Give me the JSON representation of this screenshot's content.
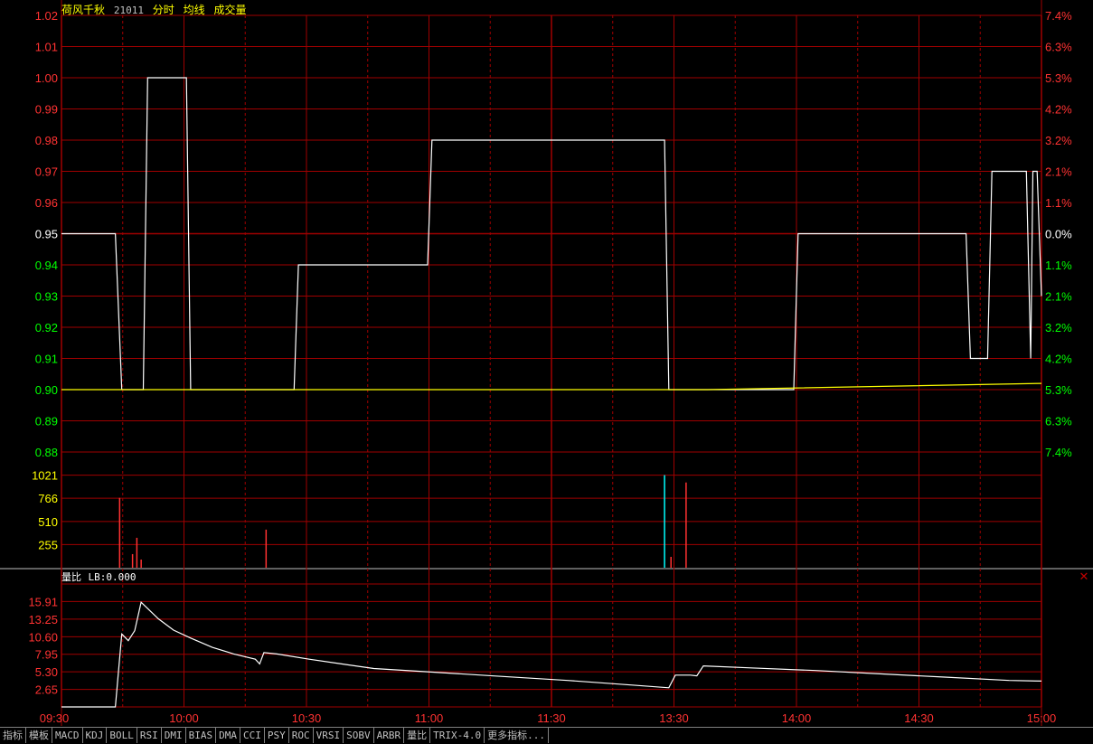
{
  "header": {
    "name": "荷风千秋",
    "code": "21011",
    "mode": "分时",
    "avg_label": "均线",
    "vol_label": "成交量"
  },
  "price_axis": {
    "left_labels": [
      "1.02",
      "1.01",
      "1.00",
      "0.99",
      "0.98",
      "0.97",
      "0.96",
      "0.95",
      "0.94",
      "0.93",
      "0.92",
      "0.91",
      "0.90",
      "0.89",
      "0.88"
    ],
    "right_labels": [
      "7.4%",
      "6.3%",
      "5.3%",
      "4.2%",
      "3.2%",
      "2.1%",
      "1.1%",
      "0.0%",
      "1.1%",
      "2.1%",
      "3.2%",
      "4.2%",
      "5.3%",
      "6.3%",
      "7.4%"
    ],
    "prev_close": 0.95
  },
  "volume_axis": {
    "labels": [
      "1021",
      "766",
      "510",
      "255"
    ]
  },
  "indicator": {
    "name": "量比",
    "value_text": "LB:0.000",
    "labels": [
      "15.91",
      "13.25",
      "10.60",
      "7.95",
      "5.30",
      "2.65"
    ]
  },
  "time_labels": [
    "09:30",
    "10:00",
    "10:30",
    "11:00",
    "11:30",
    "13:30",
    "14:00",
    "14:30",
    "15:00"
  ],
  "tabs": [
    "指标",
    "模板",
    "MACD",
    "KDJ",
    "BOLL",
    "RSI",
    "DMI",
    "BIAS",
    "DMA",
    "CCI",
    "PSY",
    "ROC",
    "VRSI",
    "SOBV",
    "ARBR",
    "量比",
    "TRIX-4.0",
    "更多指标..."
  ],
  "colors": {
    "grid": "#a00000",
    "up": "#ff3232",
    "down": "#00ff00",
    "flat": "#ffffff",
    "price_line": "#ffffff",
    "avg_line": "#ffff00",
    "volume_up": "#ff3232",
    "volume_down": "#00ffff",
    "axis_yellow": "#ffff00"
  },
  "chart_data": {
    "type": "line",
    "title": "",
    "x_unit": "minute index (0-240, 09:30-15:00)",
    "ylim": [
      0.88,
      1.02
    ],
    "series": [
      {
        "name": "",
        "points": [
          [
            0,
            0.95
          ],
          [
            25,
            0.95
          ],
          [
            28,
            0.9
          ],
          [
            38,
            0.9
          ],
          [
            40,
            1.0
          ],
          [
            58,
            1.0
          ],
          [
            60,
            0.9
          ],
          [
            108,
            0.9
          ],
          [
            110,
            0.94
          ],
          [
            170,
            0.94
          ],
          [
            172,
            0.98
          ],
          [
            280,
            0.98
          ],
          [
            282,
            0.9
          ],
          [
            296,
            0.9
          ],
          [
            300,
            0.9
          ],
          [
            340,
            0.9
          ],
          [
            342,
            0.95
          ],
          [
            420,
            0.95
          ],
          [
            422,
            0.91
          ],
          [
            430,
            0.91
          ],
          [
            432,
            0.97
          ],
          [
            448,
            0.97
          ],
          [
            450,
            0.91
          ],
          [
            451,
            0.97
          ],
          [
            453,
            0.97
          ],
          [
            455,
            0.93
          ]
        ]
      },
      {
        "name": "",
        "points": [
          [
            0,
            0.9
          ],
          [
            100,
            0.9
          ],
          [
            300,
            0.9
          ],
          [
            455,
            0.902
          ]
        ]
      }
    ],
    "volume": {
      "ylim": [
        0,
        1276
      ],
      "bars": [
        [
          27,
          770,
          "up"
        ],
        [
          33,
          150,
          "up"
        ],
        [
          35,
          330,
          "up"
        ],
        [
          37,
          90,
          "up"
        ],
        [
          95,
          420,
          "up"
        ],
        [
          280,
          1021,
          "down"
        ],
        [
          283,
          120,
          "up"
        ],
        [
          290,
          940,
          "up"
        ]
      ]
    },
    "volume_ratio": {
      "ylim": [
        0,
        18.56
      ],
      "points": [
        [
          0,
          0.0
        ],
        [
          25,
          0.0
        ],
        [
          28,
          11.0
        ],
        [
          31,
          10.0
        ],
        [
          34,
          11.5
        ],
        [
          37,
          15.8
        ],
        [
          45,
          13.3
        ],
        [
          52,
          11.6
        ],
        [
          60,
          10.4
        ],
        [
          70,
          9.0
        ],
        [
          80,
          8.0
        ],
        [
          90,
          7.2
        ],
        [
          92,
          6.5
        ],
        [
          94,
          8.2
        ],
        [
          100,
          8.0
        ],
        [
          115,
          7.2
        ],
        [
          130,
          6.5
        ],
        [
          145,
          5.8
        ],
        [
          175,
          5.2
        ],
        [
          205,
          4.6
        ],
        [
          235,
          4.0
        ],
        [
          265,
          3.3
        ],
        [
          282,
          2.9
        ],
        [
          285,
          4.8
        ],
        [
          292,
          4.8
        ],
        [
          295,
          4.7
        ],
        [
          298,
          6.2
        ],
        [
          320,
          5.9
        ],
        [
          350,
          5.5
        ],
        [
          380,
          5.0
        ],
        [
          410,
          4.5
        ],
        [
          440,
          4.0
        ],
        [
          455,
          3.9
        ]
      ]
    }
  }
}
